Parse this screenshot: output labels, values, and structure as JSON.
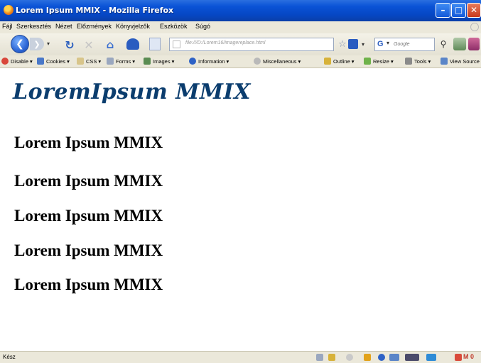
{
  "window": {
    "title": "Lorem Ipsum MMIX - Mozilla Firefox"
  },
  "menu": [
    "Fájl",
    "Szerkesztés",
    "Nézet",
    "Előzmények",
    "Könyvjelzők",
    "Eszközök",
    "Súgó"
  ],
  "navbar": {
    "url": "file:///D:/Lorem16/imagereplace.html",
    "search_placeholder": "Google",
    "search_engine_icon": "G"
  },
  "webdev_toolbar": [
    {
      "label": "Disable",
      "icon": "disable-icon",
      "color": "#d9473b"
    },
    {
      "label": "Cookies",
      "icon": "cookies-icon",
      "color": "#4a78c8"
    },
    {
      "label": "CSS",
      "icon": "css-icon",
      "color": "#d8c58a"
    },
    {
      "label": "Forms",
      "icon": "forms-icon",
      "color": "#9aa7bf"
    },
    {
      "label": "Images",
      "icon": "images-icon",
      "color": "#5a8c52"
    },
    {
      "label": "Information",
      "icon": "information-icon",
      "color": "#2e62c6"
    },
    {
      "label": "Miscellaneous",
      "icon": "miscellaneous-icon",
      "color": "#b9b9b9"
    },
    {
      "label": "Outline",
      "icon": "outline-icon",
      "color": "#d7b23a"
    },
    {
      "label": "Resize",
      "icon": "resize-icon",
      "color": "#6fb24a"
    },
    {
      "label": "Tools",
      "icon": "tools-icon",
      "color": "#8a8a8a"
    },
    {
      "label": "View Source",
      "icon": "view-source-icon",
      "color": "#5a85c8"
    }
  ],
  "page": {
    "logo_text": "LoremIpsum MMIX",
    "headings": [
      "Lorem Ipsum MMIX",
      "Lorem Ipsum MMIX",
      "Lorem Ipsum MMIX",
      "Lorem Ipsum MMIX",
      "Lorem Ipsum MMIX"
    ]
  },
  "status": {
    "text": "Kész",
    "mail_label": "M",
    "mail_count": "0"
  }
}
